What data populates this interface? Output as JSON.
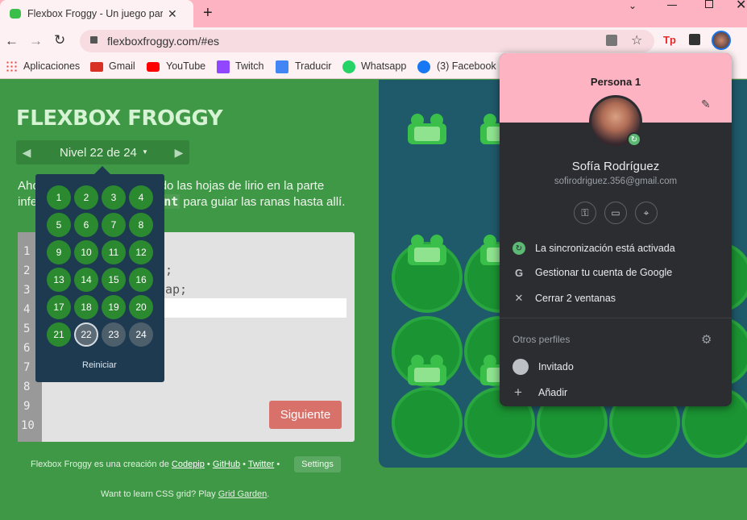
{
  "browser": {
    "tab_title": "Flexbox Froggy - Un juego para aprender CSS flexbox",
    "url": "flexboxfroggy.com/#es",
    "bookmarks": [
      {
        "label": "Aplicaciones",
        "color": "#e8453c"
      },
      {
        "label": "Gmail",
        "color": "#d93025"
      },
      {
        "label": "YouTube",
        "color": "#ff0000"
      },
      {
        "label": "Twitch",
        "color": "#9146ff"
      },
      {
        "label": "Traducir",
        "color": "#4285f4"
      },
      {
        "label": "Whatsapp",
        "color": "#25d366"
      },
      {
        "label": "(3) Facebook",
        "color": "#1877f2"
      }
    ]
  },
  "game": {
    "logo": "FLEXBOX FROGGY",
    "level_label": "Nivel 22 de 24",
    "instruction_line1": "Ahora guía las ranas hasta las hojas de lirio en la parte",
    "instruction_line2": "inferior. Usa align-content para guiar las ranas hasta allí.",
    "visible_instr_a": "Aho",
    "visible_instr_b": "do las hojas de lirio en la parte",
    "visible_instr_c": "infe",
    "visible_instr_code": "nt",
    "visible_instr_d": "para guiar las ranas hasta allí.",
    "code_line_2": ";",
    "code_line_3": "ap;",
    "line_numbers": [
      "1",
      "2",
      "3",
      "4",
      "5",
      "6",
      "7",
      "8",
      "9",
      "10"
    ],
    "next_button": "Siguiente",
    "levels": [
      "1",
      "2",
      "3",
      "4",
      "5",
      "6",
      "7",
      "8",
      "9",
      "10",
      "11",
      "12",
      "13",
      "14",
      "15",
      "16",
      "17",
      "18",
      "19",
      "20",
      "21",
      "22",
      "23",
      "24"
    ],
    "current_level": 22,
    "reset": "Reiniciar",
    "footer_prefix": "Flexbox Froggy es una creación de",
    "footer_codepip": "Codepip",
    "footer_github": "GitHub",
    "footer_twitter": "Twitter",
    "settings": "Settings",
    "footer2_prefix": "Want to learn CSS grid? Play",
    "footer2_link": "Grid Garden"
  },
  "profile": {
    "header": "Persona 1",
    "name": "Sofía Rodríguez",
    "email": "sofirodriguez.356@gmail.com",
    "sync": "La sincronización está activada",
    "manage": "Gestionar tu cuenta de Google",
    "close": "Cerrar 2 ventanas",
    "others": "Otros perfiles",
    "guest": "Invitado",
    "add": "Añadir"
  }
}
